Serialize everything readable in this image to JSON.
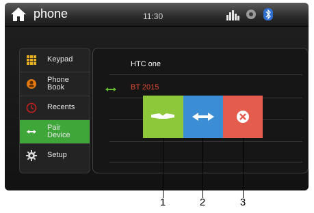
{
  "header": {
    "title": "phone",
    "time": "11:30"
  },
  "sidebar": {
    "items": [
      {
        "label_1": "Keypad",
        "label_2": "",
        "icon": "keypad-icon"
      },
      {
        "label_1": "Phone",
        "label_2": "Book",
        "icon": "phonebook-icon"
      },
      {
        "label_1": "Recents",
        "label_2": "",
        "icon": "recents-icon"
      },
      {
        "label_1": "Pair",
        "label_2": "Device",
        "icon": "pair-device-icon",
        "active": true
      },
      {
        "label_1": "Setup",
        "label_2": "",
        "icon": "gear-icon"
      }
    ]
  },
  "devices": [
    {
      "name": "HTC one",
      "connected": false
    },
    {
      "name": "BT 2015",
      "connected": true
    }
  ],
  "popup": {
    "buttons": [
      {
        "icon": "handshake-icon",
        "color": "#8dc83a"
      },
      {
        "icon": "connect-plug-icon",
        "color": "#3c8ed4"
      },
      {
        "icon": "close-icon",
        "color": "#e35c4d"
      }
    ]
  },
  "callouts": [
    "1",
    "2",
    "3"
  ],
  "colors": {
    "accent_green": "#3fa63a",
    "connected_red": "#e04a36"
  }
}
